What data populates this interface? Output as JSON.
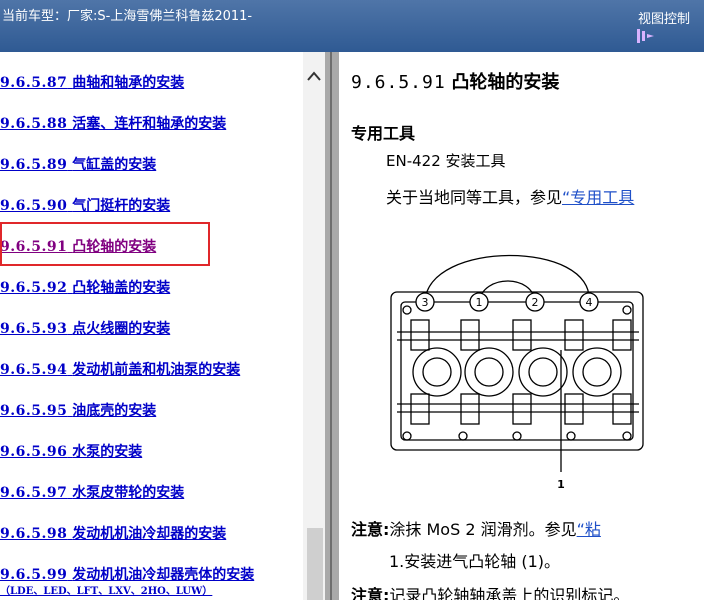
{
  "header": {
    "title": "当前车型：厂家:S-上海雪佛兰科鲁兹2011-",
    "view_control": "视图控制"
  },
  "toc": {
    "items": [
      {
        "num": "9.6.5.87",
        "label": "曲轴和轴承的安装"
      },
      {
        "num": "9.6.5.88",
        "label": "活塞、连杆和轴承的安装"
      },
      {
        "num": "9.6.5.89",
        "label": "气缸盖的安装"
      },
      {
        "num": "9.6.5.90",
        "label": "气门挺杆的安装"
      },
      {
        "num": "9.6.5.91",
        "label": "凸轮轴的安装"
      },
      {
        "num": "9.6.5.92",
        "label": "凸轮轴盖的安装"
      },
      {
        "num": "9.6.5.93",
        "label": "点火线圈的安装"
      },
      {
        "num": "9.6.5.94",
        "label": "发动机前盖和机油泵的安装"
      },
      {
        "num": "9.6.5.95",
        "label": "油底壳的安装"
      },
      {
        "num": "9.6.5.96",
        "label": "水泵的安装"
      },
      {
        "num": "9.6.5.97",
        "label": "水泵皮带轮的安装"
      },
      {
        "num": "9.6.5.98",
        "label": "发动机机油冷却器的安装"
      },
      {
        "num": "9.6.5.99",
        "label": "发动机机油冷却器壳体的安装",
        "sub": "（LDE、LED、LFT、LXV、2HO、LUW）"
      }
    ],
    "active_index": 4
  },
  "content": {
    "heading_num": "9.6.5.91",
    "heading_text": "凸轮轴的安装",
    "special_tools": "专用工具",
    "tool_line": "EN-422 安装工具",
    "ref_prefix": "关于当地同等工具，参见",
    "ref_link": "“专用工具",
    "diagram_labels": [
      "3",
      "1",
      "2",
      "4",
      "1"
    ],
    "note1_label": "注意:",
    "note1_text": "涂抹 MoS  2  润滑剂。参见",
    "note1_link": "“粘",
    "step1": "1.安装进气凸轮轴   (1)。",
    "note2_label": "注意:",
    "note2_text": "记录凸轮轴轴承盖上的识别标记。"
  }
}
